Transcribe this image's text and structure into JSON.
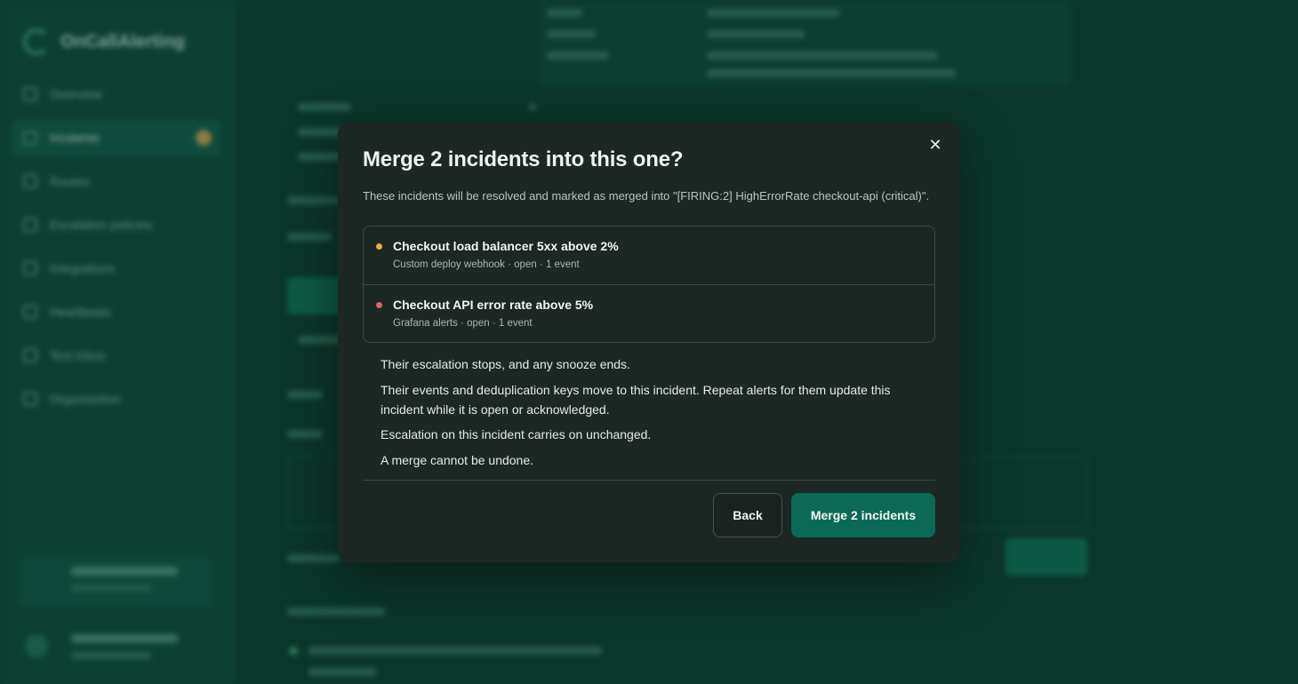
{
  "background": {
    "brand_name": "OnCallAlerting",
    "sidebar": {
      "items": [
        {
          "label": "Overview"
        },
        {
          "label": "Incidents",
          "active": true
        },
        {
          "label": "Routes"
        },
        {
          "label": "Escalation policies"
        },
        {
          "label": "Integrations"
        },
        {
          "label": "Heartbeats"
        },
        {
          "label": "Test inbox"
        },
        {
          "label": "Organization"
        }
      ]
    }
  },
  "modal": {
    "title": "Merge 2 incidents into this one?",
    "description": "These incidents will be resolved and marked as merged into \"[FIRING:2] HighErrorRate checkout-api (critical)\".",
    "close_icon": "close-icon",
    "incidents": [
      {
        "title": "Checkout load balancer 5xx above 2%",
        "subtitle": "Custom deploy webhook · open · 1 event",
        "dot_color": "#e8b04a"
      },
      {
        "title": "Checkout API error rate above 5%",
        "subtitle": "Grafana alerts · open · 1 event",
        "dot_color": "#e0606a"
      }
    ],
    "consequences": [
      "Their escalation stops, and any snooze ends.",
      "Their events and deduplication keys move to this incident. Repeat alerts for them update this incident while it is open or acknowledged.",
      "Escalation on this incident carries on unchanged.",
      "A merge cannot be undone."
    ],
    "back_label": "Back",
    "merge_label": "Merge 2 incidents",
    "accent_color": "#0b6a55"
  }
}
